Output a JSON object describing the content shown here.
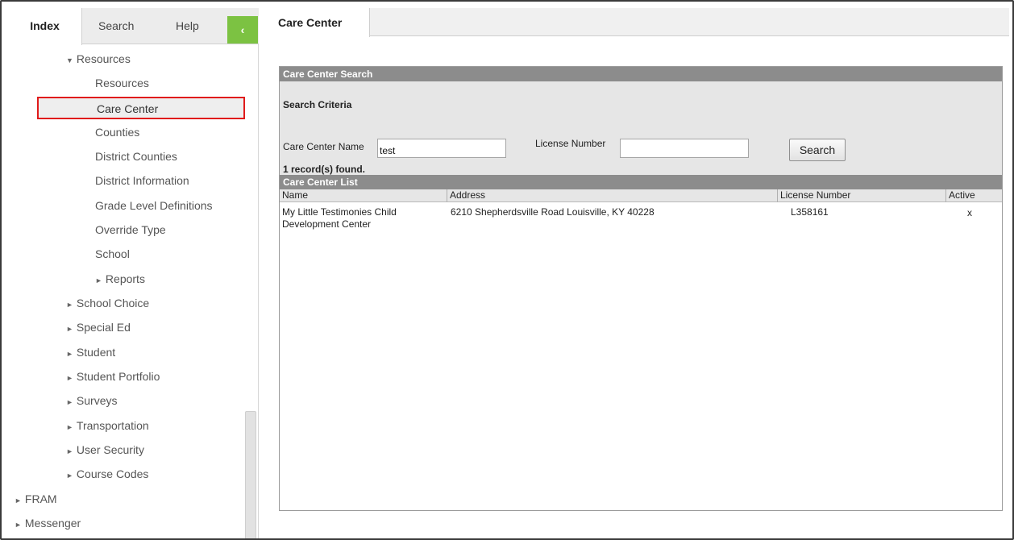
{
  "sidebar": {
    "tabs": {
      "index": "Index",
      "search": "Search",
      "help": "Help",
      "collapse": "‹"
    },
    "tree": [
      {
        "label": "Resources",
        "arrow": "▼",
        "selected": false
      },
      {
        "label": "Resources",
        "arrow": "",
        "selected": false
      },
      {
        "label": "Care Center",
        "arrow": "",
        "selected": true
      },
      {
        "label": "Counties",
        "arrow": "",
        "selected": false
      },
      {
        "label": "District Counties",
        "arrow": "",
        "selected": false
      },
      {
        "label": "District Information",
        "arrow": "",
        "selected": false
      },
      {
        "label": "Grade Level Definitions",
        "arrow": "",
        "selected": false
      },
      {
        "label": "Override Type",
        "arrow": "",
        "selected": false
      },
      {
        "label": "School",
        "arrow": "",
        "selected": false
      },
      {
        "label": "Reports",
        "arrow": "►",
        "selected": false
      },
      {
        "label": "School Choice",
        "arrow": "►",
        "selected": false
      },
      {
        "label": "Special Ed",
        "arrow": "►",
        "selected": false
      },
      {
        "label": "Student",
        "arrow": "►",
        "selected": false
      },
      {
        "label": "Student Portfolio",
        "arrow": "►",
        "selected": false
      },
      {
        "label": "Surveys",
        "arrow": "►",
        "selected": false
      },
      {
        "label": "Transportation",
        "arrow": "►",
        "selected": false
      },
      {
        "label": "User Security",
        "arrow": "►",
        "selected": false
      },
      {
        "label": "Course Codes",
        "arrow": "►",
        "selected": false
      },
      {
        "label": "FRAM",
        "arrow": "►",
        "selected": false
      },
      {
        "label": "Messenger",
        "arrow": "►",
        "selected": false
      }
    ]
  },
  "main": {
    "tab_title": "Care Center",
    "search_header": "Care Center Search",
    "criteria_title": "Search Criteria",
    "name_label": "Care Center Name",
    "name_value": "test",
    "license_label": "License Number",
    "license_value": "",
    "search_button": "Search",
    "records_found": "1 record(s) found.",
    "list_header": "Care Center List",
    "columns": [
      "Name",
      "Address",
      "License Number",
      "Active"
    ],
    "rows": [
      {
        "name_line1": "My Little Testimonies Child",
        "name_line2": "Development Center",
        "address": "6210 Shepherdsville Road Louisville, KY 40228",
        "license": "L358161",
        "active": "x"
      }
    ]
  },
  "colors": {
    "accent_green": "#7cc242",
    "highlight_red": "#e01b1b",
    "header_gray": "#8c8c8c"
  }
}
